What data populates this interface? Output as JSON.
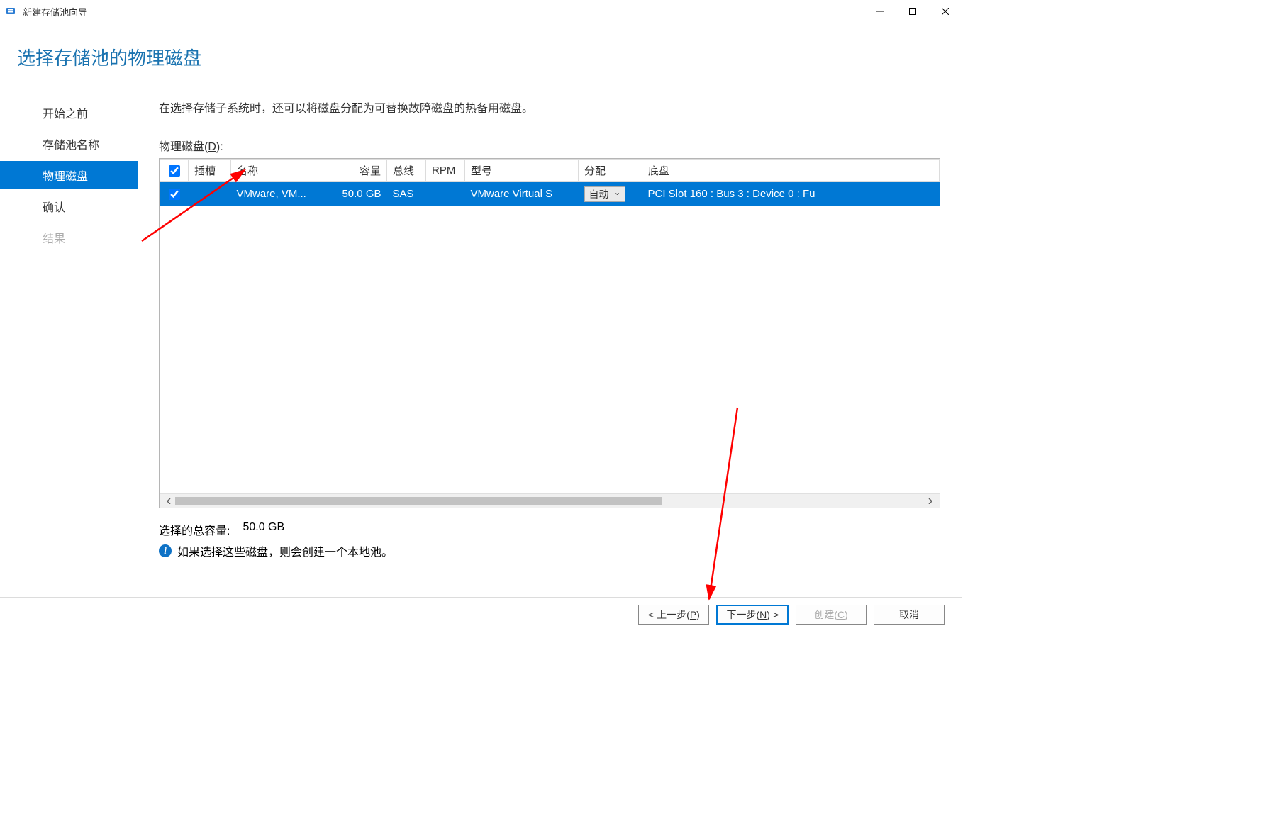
{
  "window": {
    "title": "新建存储池向导"
  },
  "heading": "选择存储池的物理磁盘",
  "sidebar": {
    "items": [
      {
        "label": "开始之前",
        "state": "normal"
      },
      {
        "label": "存储池名称",
        "state": "normal"
      },
      {
        "label": "物理磁盘",
        "state": "active"
      },
      {
        "label": "确认",
        "state": "normal"
      },
      {
        "label": "结果",
        "state": "disabled"
      }
    ]
  },
  "main": {
    "description": "在选择存储子系统时，还可以将磁盘分配为可替换故障磁盘的热备用磁盘。",
    "table_label_prefix": "物理磁盘(",
    "table_label_key": "D",
    "table_label_suffix": "):",
    "columns": {
      "checkbox": "",
      "slot": "插槽",
      "name": "名称",
      "capacity": "容量",
      "bus": "总线",
      "rpm": "RPM",
      "model": "型号",
      "allocation": "分配",
      "chassis": "底盘"
    },
    "rows": [
      {
        "checked": true,
        "slot": "",
        "name": "VMware, VM...",
        "capacity": "50.0 GB",
        "bus": "SAS",
        "rpm": "",
        "model": "VMware Virtual S",
        "allocation": "自动",
        "chassis": "PCI Slot 160 : Bus 3 : Device 0 : Fu"
      }
    ],
    "summary": {
      "label": "选择的总容量:",
      "value": "50.0 GB"
    },
    "info_note": "如果选择这些磁盘，则会创建一个本地池。"
  },
  "footer": {
    "prev_prefix": "< 上一步(",
    "prev_key": "P",
    "prev_suffix": ")",
    "next_prefix": "下一步(",
    "next_key": "N",
    "next_suffix": ") >",
    "create_prefix": "创建(",
    "create_key": "C",
    "create_suffix": ")",
    "cancel": "取消"
  }
}
